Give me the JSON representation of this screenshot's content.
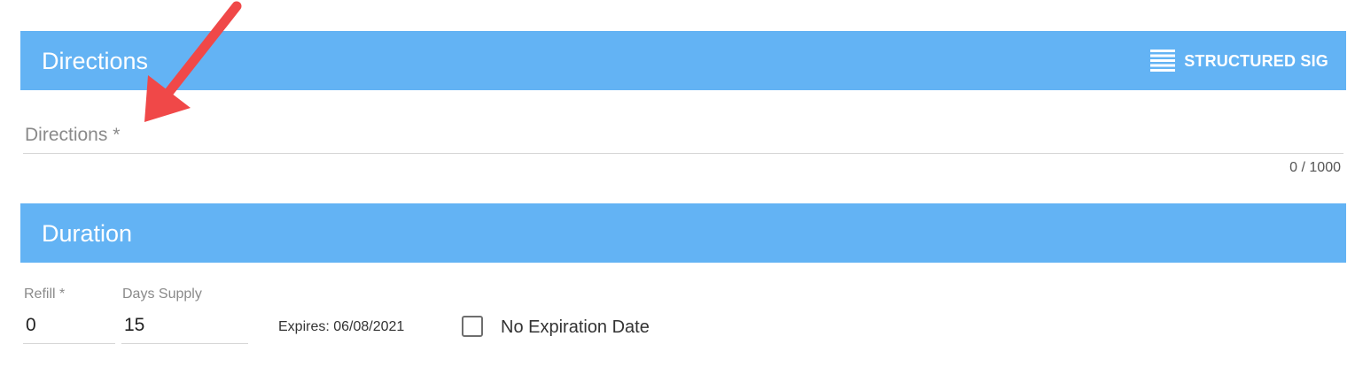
{
  "directions_section": {
    "title": "Directions",
    "structured_sig_label": "STRUCTURED SIG",
    "field_placeholder": "Directions *",
    "char_counter": "0 / 1000"
  },
  "duration_section": {
    "title": "Duration",
    "refill": {
      "label": "Refill *",
      "value": "0"
    },
    "days_supply": {
      "label": "Days Supply",
      "value": "15"
    },
    "expires_text": "Expires: 06/08/2021",
    "no_expiration": {
      "label": "No Expiration Date",
      "checked": false
    }
  },
  "colors": {
    "header_bg": "#63b3f4",
    "annotation_arrow": "#f04848"
  },
  "icons": {
    "structured_sig": "list-lines-icon",
    "annotation": "red-arrow-annotation"
  }
}
